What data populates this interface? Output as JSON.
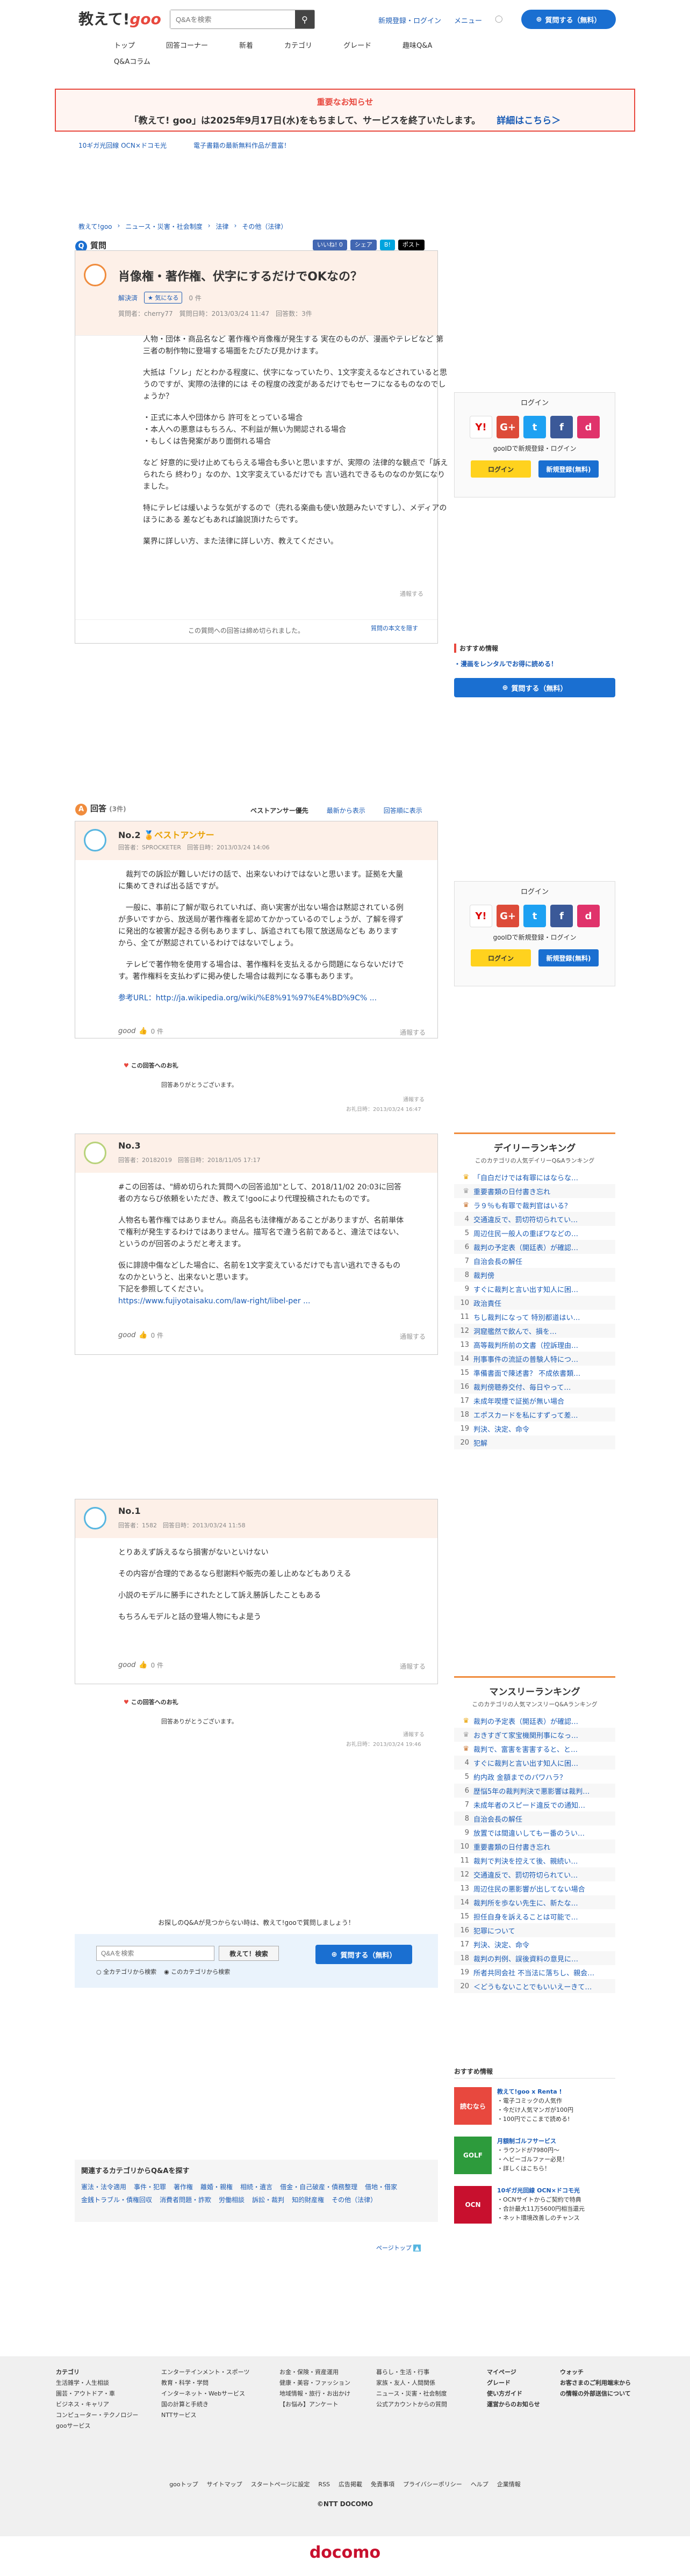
{
  "header": {
    "logo_text": "教えて!",
    "logo_brand": "goo",
    "search_placeholder": "Q&Aを検索",
    "links": [
      "新規登録・ログイン",
      "メニュー"
    ],
    "ask_button": "質問する（無料）",
    "nav": [
      "トップ",
      "回答コーナー",
      "新着",
      "カテゴリ",
      "グレード",
      "趣味Q&A"
    ],
    "nav_extra": "Q&Aコラム"
  },
  "notice": {
    "title": "重要なお知らせ",
    "text": "「教えて! goo」は2025年9月17日(水)をもちまして、サービスを終了いたします。",
    "link": "詳細はこちら＞"
  },
  "sublinks": [
    "10ギガ光回線 OCN×ドコモ光",
    "電子書籍の最新無料作品が豊富！"
  ],
  "breadcrumb": [
    "教えて!goo",
    "ニュース・災害・社会制度",
    "法律",
    "その他（法律）"
  ],
  "question": {
    "label": "質問",
    "social": [
      "いいね! 0",
      "シェア",
      "B!",
      "ポスト"
    ],
    "title": "肖像権・著作権、伏字にするだけでOKなの？",
    "status": "解決済",
    "good": "気になる",
    "count": "0 件",
    "meta": "質問者：cherry77　質問日時：2013/03/24 11:47　回答数：3件",
    "body": [
      "人物・団体・商品名など 著作権や肖像権が発生する 実在のものが、漫画やテレビなど 第三者の制作物に登場する場面をたびたび見かけます。",
      "大抵は「ソレ」だとわかる程度に、伏字になっていたり、1文字変えるなどされていると思うのですが、実際の法律的には その程度の改変があるだけでもセーフになるものなのでしょうか？",
      "・正式に本人や団体から 許可をとっている場合\n・本人への悪意はもちろん、不利益が無い为開認される場合\n・もしくは告発案があり面倒れる場合",
      "など 好意的に受け止めてもらえる場合も多いと思いますが、実際の 法律的な観点で「訴えられたら 終わり」なのか、1文字変えているだけでも 言い逃れできるものなのか気になりました。",
      "特にテレビは緩いような気がするので（売れる楽曲も使い放題みたいですし）、メディアのほうにある 差などもあれば論説頂けたらです。",
      "業界に詳しい方、また法律に詳しい方、教えてください。"
    ],
    "report": "通報する",
    "closed": "この質問への回答は締め切られました。",
    "read_more": "質問の本文を隠す"
  },
  "login_box": {
    "title": "ログイン",
    "subtitle": "gooIDで新規登録・ログイン",
    "login": "ログイン",
    "register": "新規登録(無料)"
  },
  "side_info": {
    "title": "おすすめ情報",
    "link": "・漫画をレンタルでお得に読める！",
    "ask": "質問する（無料）"
  },
  "answers_header": {
    "label": "回答",
    "count": "(3件)",
    "sort": [
      "ベストアンサー優先",
      "最新から表示",
      "回答順に表示"
    ]
  },
  "answers": [
    {
      "num": "No.2",
      "badge": "ベストアンサー",
      "meta": "回答者：SPROCKETER　回答日時：2013/03/24 14:06",
      "body": [
        "　裁判での訴訟が難しいだけの話で、出来ないわけではないと思います。証拠を大量に集めてきれば出る話ですが。",
        "　一般に、事前に了解が取られていれば、商い実害が出ない場合は黙認されている例が多いですから、放送局が著作権者を認めてかかっているのでしょうが、了解を得ずに発出的な被害が起きる例もありますし、訴追されても限て放送局なども ありますから、全てが黙認されているわけではないでしょう。",
        "　テレビで著作物を使用する場合は、著作権料を支払えるから問題にならないだけです。著作権料を支払わずに掲み使した場合は裁判になる事もあります。"
      ],
      "ref": "参考URL：http://ja.wikipedia.org/wiki/%E8%91%97%E4%BD%9C% ...",
      "good": "good",
      "good_count": "0 件",
      "report": "通報する",
      "thanks_label": "この回答へのお礼",
      "thanks": "回答ありがとうございます。",
      "thanks_report": "通報する",
      "thanks_date": "お礼日時：2013/03/24 16:47"
    },
    {
      "num": "No.3",
      "meta": "回答者：20182019　回答日時：2018/11/05 17:17",
      "body": [
        "#この回答は、\"締め切られた質問への回答追加\"として、2018/11/02 20:03に回答者の方ならび依頼をいただき、教えて!gooにより代理投稿されたものです。",
        "人物名も著作権ではありません。商品名も法律権があることがありますが、名前単体で権利が発生するわけではありません。描写名で違う名前であると、違法ではない、というのが回答のようだと考えます。",
        "仮に誹謗中傷などした場合に、名前を1文字変えているだけでも言い逃れできるものなのかというと、出来ないと思います。\n下記を参照してください。"
      ],
      "ref": "https://www.fujiyotaisaku.com/law-right/libel-per ...",
      "good": "good",
      "good_count": "0 件",
      "report": "通報する"
    },
    {
      "num": "No.1",
      "meta": "回答者：1582　回答日時：2013/03/24 11:58",
      "body": [
        "とりあえず訴えるなら損害がないといけない",
        "その内容が合理的であるなら慰謝料や販売の差し止めなどもありえる",
        "小説のモデルに勝手にされたとして訴え勝訴したこともある",
        "もちろんモデルと話の登場人物にもよ是う"
      ],
      "good": "good",
      "good_count": "0 件",
      "report": "通報する",
      "thanks_label": "この回答へのお礼",
      "thanks": "回答ありがとうございます。",
      "thanks_report": "通報する",
      "thanks_date": "お礼日時：2013/03/24 19:46"
    }
  ],
  "daily_ranking": {
    "title": "デイリーランキング",
    "sub": "このカテゴリの人気デイリーQ&Aランキング",
    "items": [
      "「自白だけでは有罪にはならな…",
      "重要書類の日付書き忘れ",
      "ラ９％も有罪で裁判官はいる？",
      "交通違反で、罰切符切られてい…",
      "周辺住民一般人の重ぼワなどの…",
      "裁判の予定表（開廷表）が確認…",
      "自治会長の解任",
      "裁判傍",
      "すぐに裁判と言い出す知人に困…",
      "政治責任",
      "ちし裁判になって 特別都道はい…",
      "洞窟艦然で飲んで、損を…",
      "高等裁判所前の文書（控訴理由…",
      "刑事事件の流証の普験人特につ…",
      "準備書面で陳述書？ 不成依書類…",
      "裁判傍聴券交付、毎日やって…",
      "未成年喫煙で証拠が無い場合",
      "エポスカードを私にすずって差…",
      "判決、決定、命令",
      "犯解"
    ]
  },
  "monthly_ranking": {
    "title": "マンスリーランキング",
    "sub": "このカテゴリの人気マンスリーQ&Aランキング",
    "items": [
      "裁判の予定表（開廷表）が確認…",
      "おきすぎて家宝機関刑事になっ…",
      "裁判で、富害を害害すると、と…",
      "すぐに裁判と言い出す知人に困…",
      "約内政 金額までのパワハラ？",
      "歴悩5年の裁判判決で悪影響は裁判…",
      "未成年者のスピード違反での通知…",
      "自治会長の解任",
      "放置では間違いしてもー番のうい…",
      "重要書類の日付書き忘れ",
      "裁判で判決を控えて後、親続い…",
      "交通違反で、罰切符切られてい…",
      "周辺住民の悪影響が出してない場合",
      "裁判所を歩ない先生に、新たな…",
      "担任自身を訴えることは可能で…",
      "犯罪について",
      "判決、決定、命令",
      "裁判の判例、誤後資料の意見に…",
      "所者共同会社 不当法に落ちし、親会…",
      "＜どうもないことでもいいえーきて…"
    ]
  },
  "side_promos": {
    "title": "おすすめ情報",
    "items": [
      {
        "head": "教えて!goo x Renta !",
        "lines": [
          "・電子コミックの人気作",
          "・今だけ人気マンガが100円",
          "・100円でここまで読める!"
        ]
      },
      {
        "head": "月額制ゴルフサービス",
        "lines": [
          "・ラウンドが7980円〜",
          "・ヘビーゴルファー必見！",
          "・詳しくはこちら！"
        ]
      },
      {
        "head": "10ギガ光回線 OCN×ドコモ光",
        "lines": [
          "・OCNサイトからご契約で特典",
          "・合計最大11万5600円相当還元",
          "・ネット環境改善しのチャンス"
        ]
      }
    ],
    "badges": [
      "読むなら",
      "GOLF",
      "OCN"
    ]
  },
  "bottom_search": {
    "prompt": "お探しのQ&Aが見つからない時は、教えて!gooで質問しましょう！",
    "placeholder": "Q&Aを検索",
    "search_btn": "教えて！検索",
    "ask_btn": "質問する（無料）",
    "radio": [
      "全カテゴリから検索",
      "このカテゴリから検索"
    ]
  },
  "related": {
    "title": "関連するカテゴリからQ&Aを探す",
    "links": [
      "憲法・法令適用",
      "事件・犯罪",
      "著作権",
      "離婚・親権",
      "相続・遺言",
      "借金・自己破産・債務整理",
      "借地・借家",
      "金銭トラブル・債権回収",
      "消費者問題・詐欺",
      "労働相談",
      "訴訟・裁判",
      "知的財産権",
      "その他（法律）"
    ],
    "pagetop": "ページトップ"
  },
  "footer": {
    "cols": [
      [
        "カテゴリ",
        "生活雑学・人生相談",
        "園芸・アウトドア・車",
        "ビジネス・キャリア",
        "コンピューター・テクノロジー",
        "gooサービス"
      ],
      [
        "エンターテインメント・スポーツ",
        "教育・科学・学問",
        "インターネット・Webサービス",
        "国の計算と手続き",
        "NTTサービス"
      ],
      [
        "お金・保険・資産運用",
        "健康・美容・ファッション",
        "地域情報・旅行・お出かけ",
        "【お悩み】アンケート"
      ],
      [
        "暮らし・生活・行事",
        "家族・友人・人間関係",
        "ニュース・災害・社会制度",
        "公式アカウントからの質問"
      ],
      [
        "マイページ",
        "グレード",
        "使い方ガイド",
        "運営からのお知らせ"
      ],
      [
        "ウォッチ",
        "お客さまのご利用端末からの情報の外部送信について"
      ]
    ],
    "bottom_links": [
      "gooトップ",
      "サイトマップ",
      "スタートページに設定",
      "RSS",
      "広告掲載",
      "免責事項",
      "プライバシーポリシー",
      "ヘルプ",
      "企業情報"
    ],
    "copyright": "©NTT DOCOMO",
    "brand": "docomo"
  }
}
